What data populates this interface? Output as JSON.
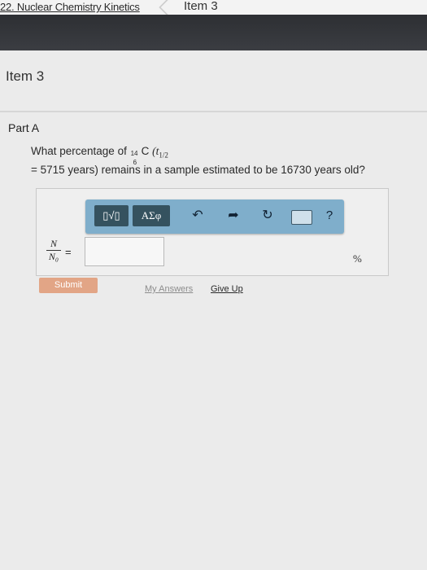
{
  "breadcrumb": {
    "course": "22. Nuclear Chemistry Kinetics",
    "item": "Item 3"
  },
  "page": {
    "item_title": "Item 3",
    "part_title": "Part A"
  },
  "question": {
    "line1_prefix": "What percentage of",
    "isotope_mass": "14",
    "isotope_atomic": "6",
    "isotope_symbol": "C",
    "halflife_open": "(t",
    "halflife_sub": "1/2",
    "line2": "= 5715 years) remains in a sample estimated to be 16730 years old?"
  },
  "toolbar": {
    "templates_label": "▯√▯",
    "symbols_label": "ΑΣφ",
    "undo_icon": "↶",
    "redo_icon": "➦",
    "reset_icon": "↻",
    "help_icon": "?"
  },
  "answer": {
    "fraction_num": "N",
    "fraction_den": "N₀",
    "equals": "=",
    "value": "",
    "unit": "%"
  },
  "actions": {
    "submit": "Submit",
    "my_answers": "My Answers",
    "give_up": "Give Up"
  }
}
